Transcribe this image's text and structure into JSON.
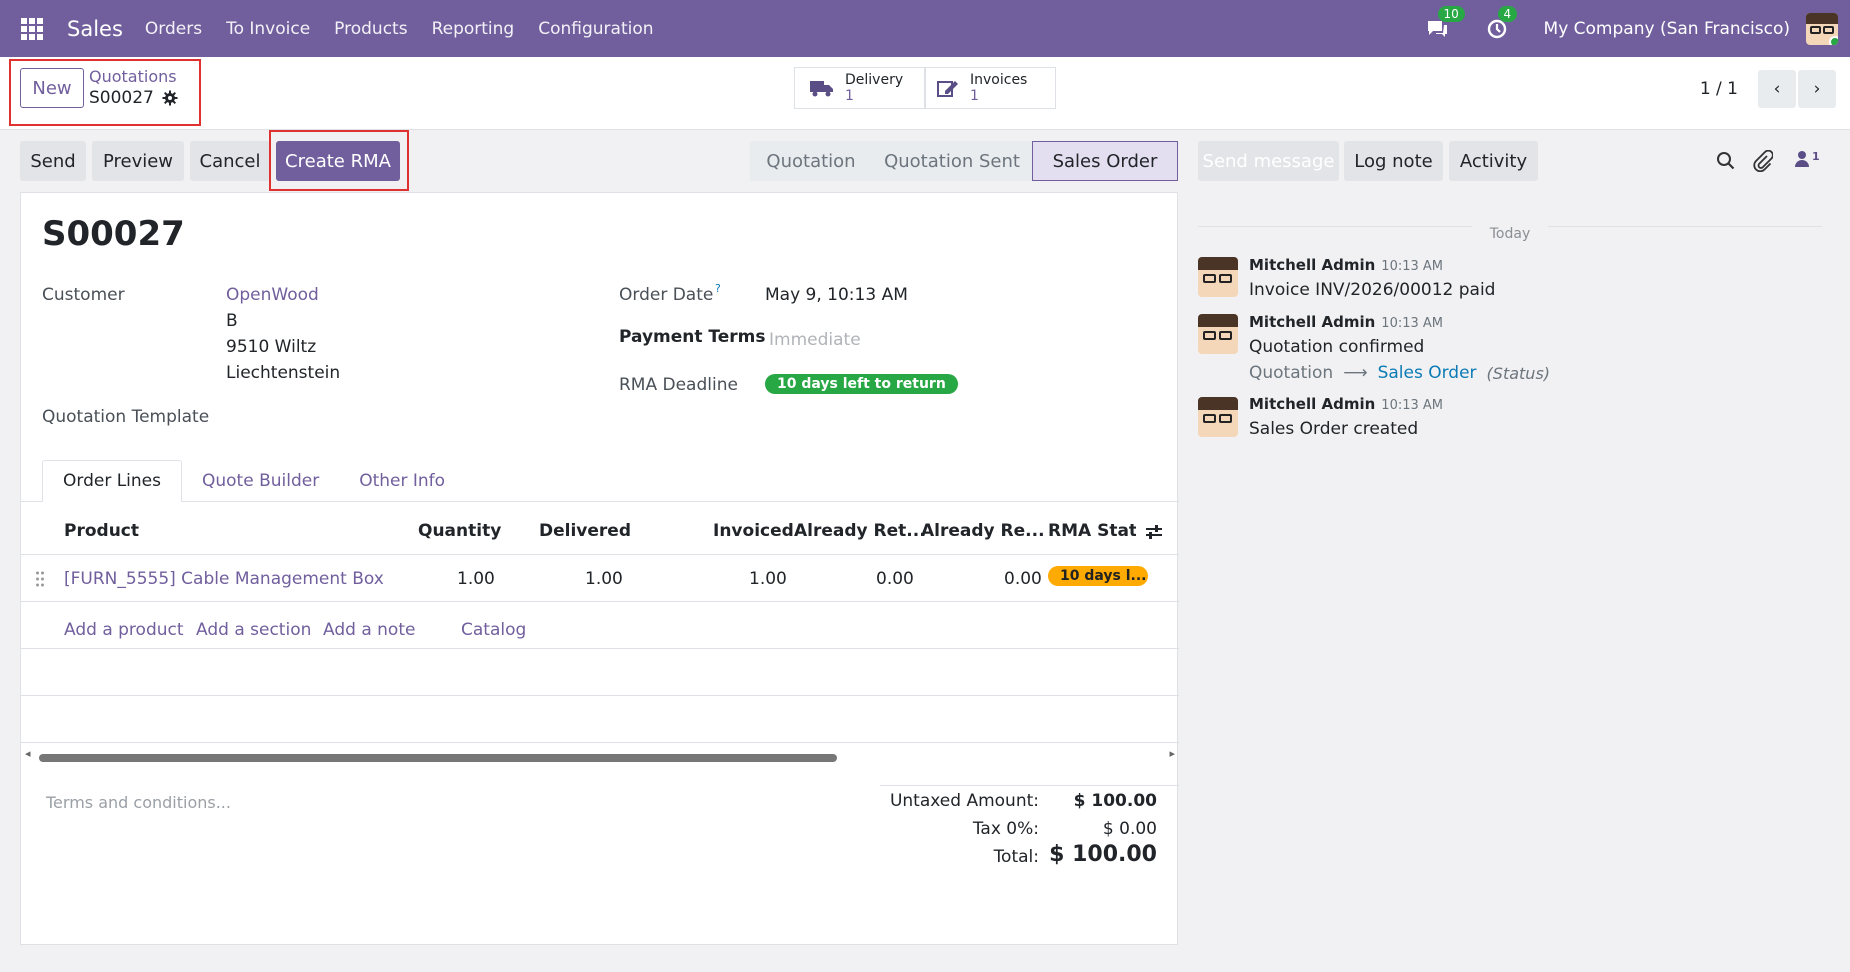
{
  "app": {
    "name": "Sales",
    "menus": [
      "Orders",
      "To Invoice",
      "Products",
      "Reporting",
      "Configuration"
    ],
    "messages_count": "10",
    "activities_count": "4",
    "company": "My Company (San Francisco)"
  },
  "control": {
    "new_label": "New",
    "breadcrumb_parent": "Quotations",
    "breadcrumb_current": "S00027",
    "smart": [
      {
        "label": "Delivery",
        "value": "1"
      },
      {
        "label": "Invoices",
        "value": "1"
      }
    ],
    "pager": "1 / 1"
  },
  "actions": {
    "send": "Send",
    "preview": "Preview",
    "cancel": "Cancel",
    "create_rma": "Create RMA"
  },
  "status": {
    "steps": [
      "Quotation",
      "Quotation Sent",
      "Sales Order"
    ],
    "active": "Sales Order"
  },
  "form": {
    "title": "S00027",
    "customer_label": "Customer",
    "customer_name": "OpenWood",
    "customer_line1": "B",
    "customer_line2": "9510 Wiltz",
    "customer_line3": "Liechtenstein",
    "template_label": "Quotation Template",
    "order_date_label": "Order Date",
    "order_date_help": "?",
    "order_date": "May 9, 10:13 AM",
    "payment_terms_label": "Payment Terms",
    "payment_terms_placeholder": "Immediate",
    "rma_deadline_label": "RMA Deadline",
    "rma_deadline": "10 days left to return"
  },
  "tabs": [
    "Order Lines",
    "Quote Builder",
    "Other Info"
  ],
  "table": {
    "headers": [
      "Product",
      "Quantity",
      "Delivered",
      "Invoiced",
      "Already Ret...",
      "Already Re...",
      "RMA Statu:"
    ],
    "rows": [
      {
        "product": "[FURN_5555] Cable Management Box",
        "quantity": "1.00",
        "delivered": "1.00",
        "invoiced": "1.00",
        "ret1": "0.00",
        "ret2": "0.00",
        "rma_status": "10 days l..."
      }
    ],
    "add_links": [
      "Add a product",
      "Add a section",
      "Add a note",
      "Catalog"
    ]
  },
  "totals": {
    "terms_placeholder": "Terms and conditions...",
    "untaxed_label": "Untaxed Amount:",
    "untaxed": "$ 100.00",
    "tax_label": "Tax 0%:",
    "tax": "$ 0.00",
    "total_label": "Total:",
    "total": "$ 100.00"
  },
  "chatter": {
    "send_message": "Send message",
    "log_note": "Log note",
    "activity": "Activity",
    "followers": "1",
    "today": "Today",
    "messages": [
      {
        "author": "Mitchell Admin",
        "time": "10:13 AM",
        "body": "Invoice INV/2026/00012 paid"
      },
      {
        "author": "Mitchell Admin",
        "time": "10:13 AM",
        "body": "Quotation confirmed",
        "tracking_from": "Quotation",
        "tracking_to": "Sales Order",
        "tracking_field": "(Status)"
      },
      {
        "author": "Mitchell Admin",
        "time": "10:13 AM",
        "body": "Sales Order created"
      }
    ]
  },
  "colors": {
    "brand": "#715f9d",
    "success": "#28a745",
    "warning": "#ffaa00",
    "highlight": "#e03131"
  }
}
